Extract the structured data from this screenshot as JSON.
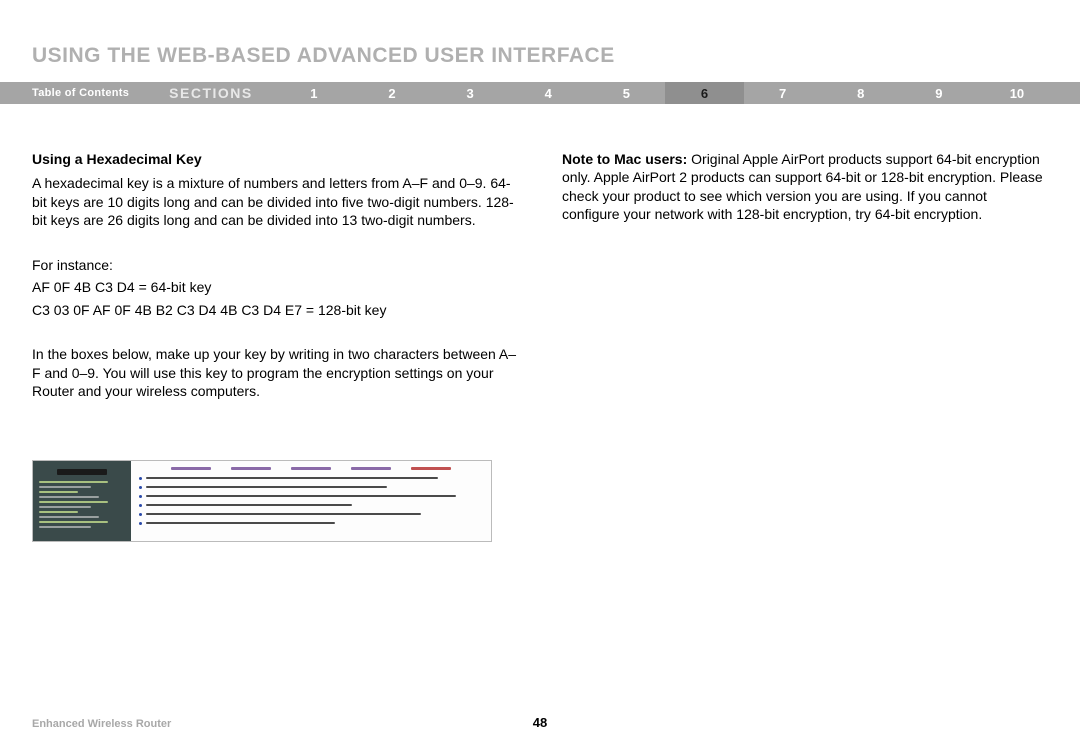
{
  "header": {
    "title": "USING THE WEB-BASED ADVANCED USER INTERFACE"
  },
  "nav": {
    "toc": "Table of Contents",
    "sections_label": "SECTIONS",
    "items": [
      "1",
      "2",
      "3",
      "4",
      "5",
      "6",
      "7",
      "8",
      "9",
      "10"
    ],
    "active_index": 5
  },
  "body": {
    "left": {
      "subhead": "Using a Hexadecimal Key",
      "p1": "A hexadecimal key is a mixture of numbers and letters from A–F and 0–9. 64-bit keys are 10 digits long and can be divided into five two-digit numbers. 128-bit keys are 26 digits long and can be divided into 13 two-digit numbers.",
      "p2": "For instance:",
      "p3": "AF 0F 4B C3 D4 = 64-bit key",
      "p4": "C3 03 0F AF 0F 4B B2 C3 D4 4B C3 D4 E7 = 128-bit key",
      "p5": "In the boxes below, make up your key by writing in two characters between A–F and 0–9. You will use this key to program the encryption settings on your Router and your wireless computers."
    },
    "right": {
      "note_label": "Note to Mac users:",
      "note_text": " Original Apple AirPort products support 64-bit encryption only. Apple AirPort 2 products can support 64-bit or 128-bit encryption. Please check your product to see which version you are using. If you cannot configure your network with 128-bit encryption, try 64-bit encryption."
    }
  },
  "footer": {
    "left": "Enhanced Wireless Router",
    "page": "48"
  }
}
